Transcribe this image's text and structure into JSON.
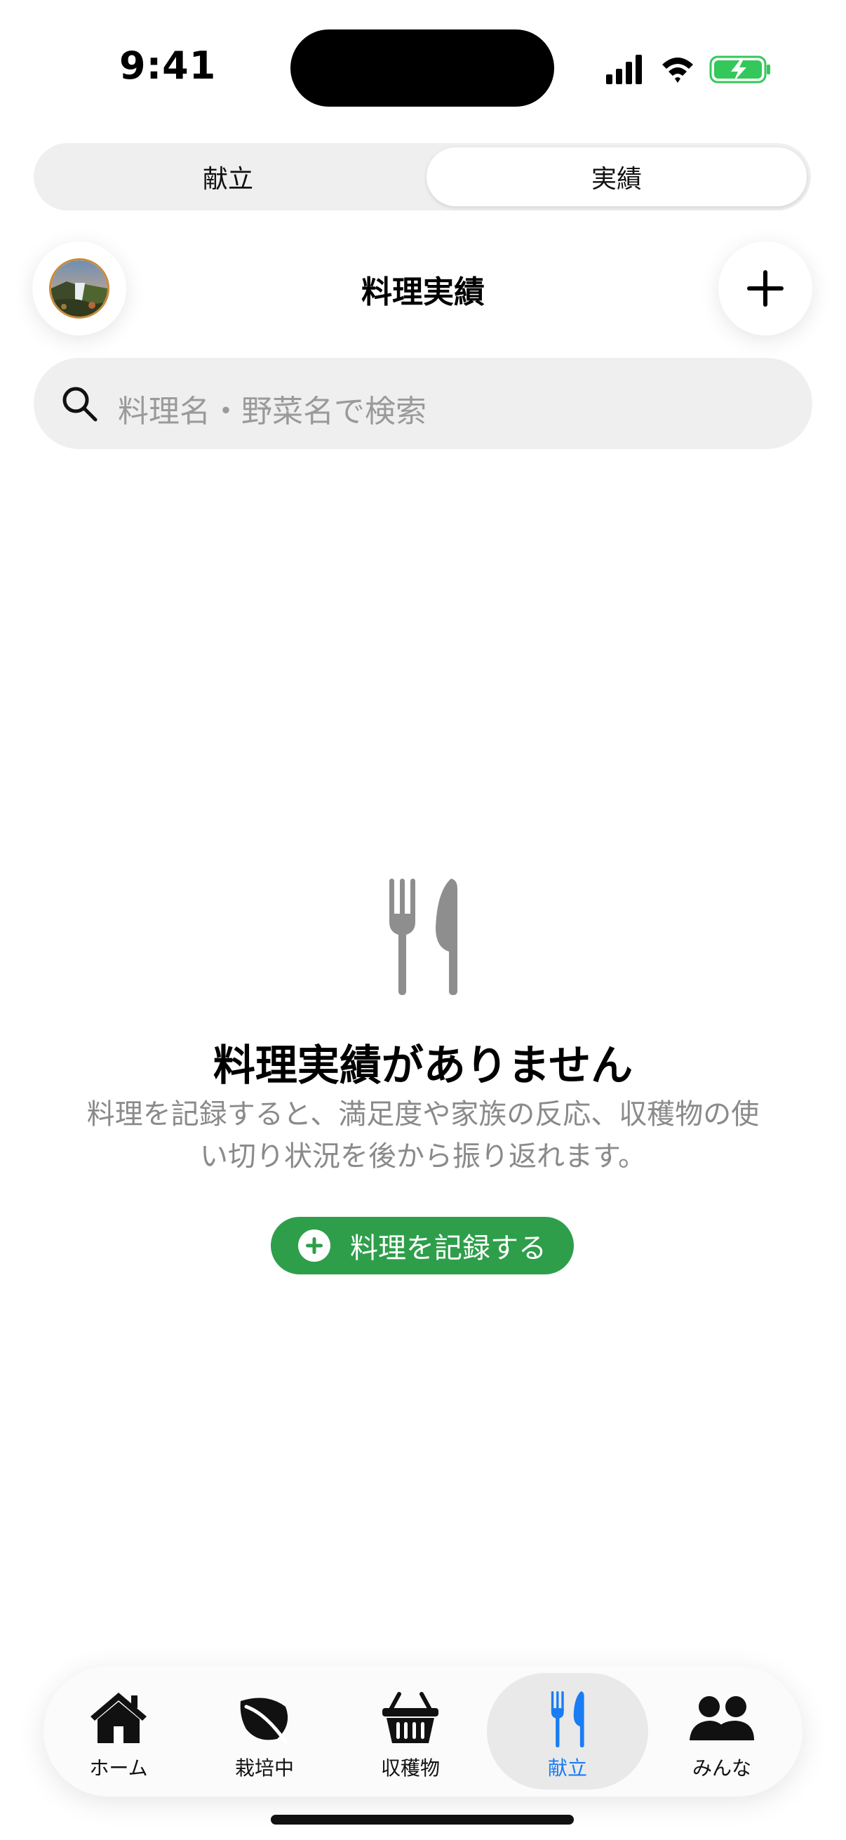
{
  "status_bar": {
    "time": "9:41"
  },
  "segmented": {
    "tabs": [
      {
        "label": "献立",
        "selected": false
      },
      {
        "label": "実績",
        "selected": true
      }
    ]
  },
  "header": {
    "title": "料理実績",
    "avatar_icon": "profile-photo",
    "add_icon": "plus-icon"
  },
  "search": {
    "placeholder": "料理名・野菜名で検索",
    "icon": "search-icon"
  },
  "empty_state": {
    "icon": "fork-knife-icon",
    "title": "料理実績がありません",
    "description_line1": "料理を記録すると、満足度や家族の反応、収穫物の使",
    "description_line2": "い切り状況を後から振り返れます。",
    "button_label": "料理を記録する"
  },
  "tab_bar": {
    "items": [
      {
        "label": "ホーム",
        "icon": "house-icon"
      },
      {
        "label": "栽培中",
        "icon": "leaf-icon"
      },
      {
        "label": "収穫物",
        "icon": "basket-icon"
      },
      {
        "label": "献立",
        "icon": "fork-knife-icon",
        "active": true
      },
      {
        "label": "みんな",
        "icon": "people-icon"
      }
    ]
  },
  "colors": {
    "accent_green": "#2e9e4a",
    "active_tab_blue": "#1a7cf2",
    "battery_green": "#34c759"
  }
}
